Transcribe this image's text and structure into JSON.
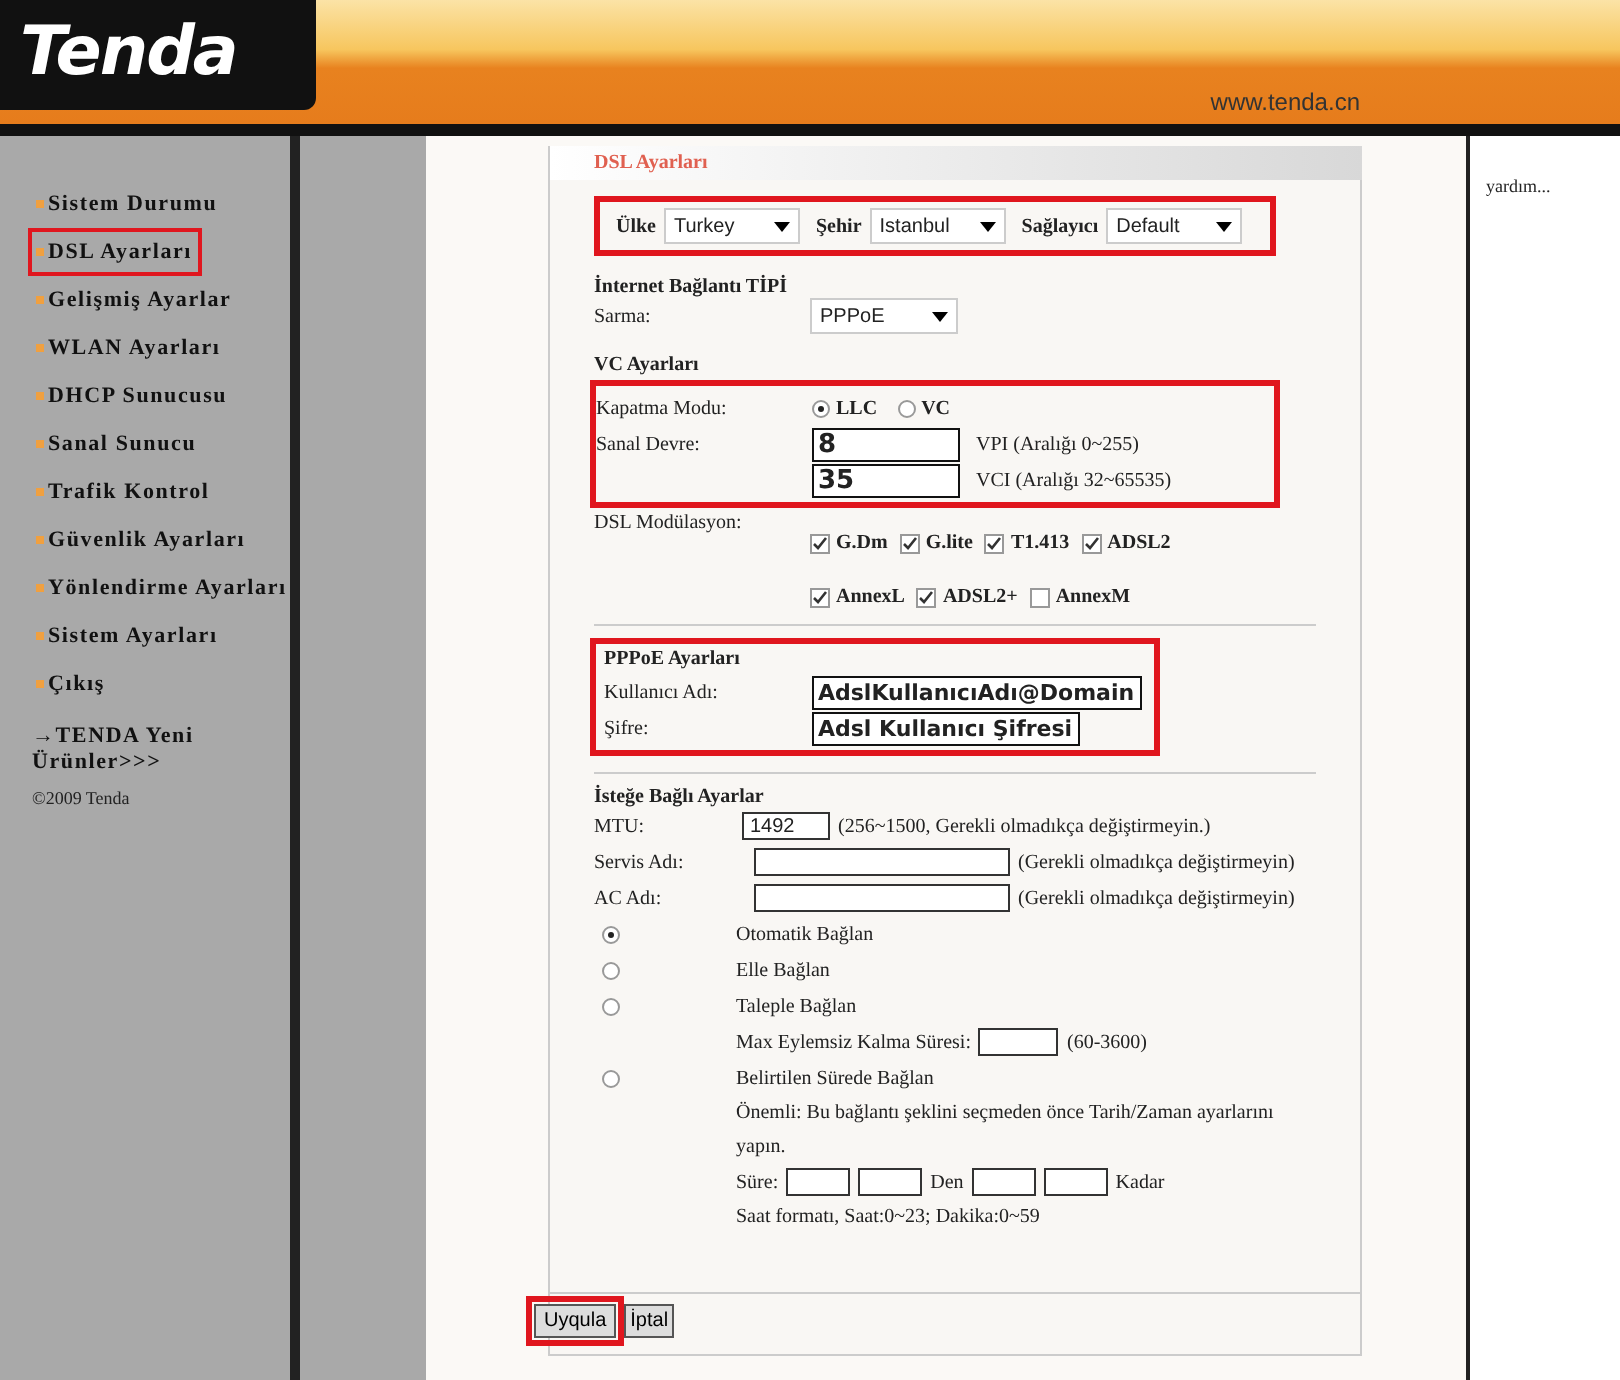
{
  "header": {
    "logo": "Tenda",
    "url": "www.tenda.cn"
  },
  "sidebar": {
    "items": [
      {
        "label": "Sistem Durumu",
        "selected": false
      },
      {
        "label": "DSL Ayarları",
        "selected": true
      },
      {
        "label": "Gelişmiş Ayarlar",
        "selected": false
      },
      {
        "label": "WLAN Ayarları",
        "selected": false
      },
      {
        "label": "DHCP Sunucusu",
        "selected": false
      },
      {
        "label": "Sanal Sunucu",
        "selected": false
      },
      {
        "label": "Trafik Kontrol",
        "selected": false
      },
      {
        "label": "Güvenlik Ayarları",
        "selected": false
      },
      {
        "label": "Yönlendirme Ayarları",
        "selected": false
      },
      {
        "label": "Sistem Ayarları",
        "selected": false
      },
      {
        "label": "Çıkış",
        "selected": false
      }
    ],
    "promo": "→TENDA Yeni Ürünler>>>",
    "copyright": "©2009 Tenda"
  },
  "panel_title": "DSL Ayarları",
  "location": [
    {
      "label": "Ülke",
      "value": "Turkey"
    },
    {
      "label": "Şehir",
      "value": "Istanbul"
    },
    {
      "label": "Sağlayıcı",
      "value": "Default"
    }
  ],
  "connection_type": {
    "heading": "İnternet Bağlantı TİPİ",
    "label": "Sarma:",
    "value": "PPPoE"
  },
  "vc": {
    "heading": "VC Ayarları",
    "mode_label": "Kapatma Modu:",
    "modes": [
      {
        "label": "LLC",
        "selected": true
      },
      {
        "label": "VC",
        "selected": false
      }
    ],
    "circuit_label": "Sanal Devre:",
    "vpi": {
      "value": "8",
      "hint": "VPI (Aralığı 0~255)"
    },
    "vci": {
      "value": "35",
      "hint": "VCI (Aralığı 32~65535)"
    },
    "modulation_label": "DSL Modülasyon:",
    "modulations": [
      {
        "label": "G.Dm",
        "checked": true
      },
      {
        "label": "G.lite",
        "checked": true
      },
      {
        "label": "T1.413",
        "checked": true
      },
      {
        "label": "ADSL2",
        "checked": true
      },
      {
        "label": "AnnexL",
        "checked": true
      },
      {
        "label": "ADSL2+",
        "checked": true
      },
      {
        "label": "AnnexM",
        "checked": false
      }
    ]
  },
  "pppoe": {
    "heading": "PPPoE Ayarları",
    "user_label": "Kullanıcı Adı:",
    "user_value": "AdslKullanıcıAdı@Domain",
    "password_label": "Şifre:",
    "password_value": "Adsl Kullanıcı Şifresi"
  },
  "optional": {
    "heading": "İsteğe Bağlı Ayarlar",
    "mtu": {
      "label": "MTU:",
      "value": "1492",
      "hint": "(256~1500, Gerekli olmadıkça değiştirmeyin.)"
    },
    "service": {
      "label": "Servis Adı:",
      "hint": "(Gerekli olmadıkça değiştirmeyin)"
    },
    "ac": {
      "label": "AC Adı:",
      "hint": "(Gerekli olmadıkça değiştirmeyin)"
    },
    "modes": [
      {
        "label": "Otomatik Bağlan",
        "selected": true
      },
      {
        "label": "Elle Bağlan",
        "selected": false
      },
      {
        "label": "Taleple Bağlan",
        "selected": false
      },
      {
        "label": "Belirtilen Sürede Bağlan",
        "selected": false
      }
    ],
    "idle": {
      "label": "Max Eylemsiz Kalma Süresi:",
      "hint": "(60-3600)"
    },
    "note": "Önemli: Bu bağlantı şeklini seçmeden önce Tarih/Zaman ayarlarını yapın.",
    "time": {
      "label": "Süre:",
      "from": "Den",
      "to": "Kadar"
    },
    "format": "Saat formatı, Saat:0~23; Dakika:0~59"
  },
  "buttons": [
    "Uyqula",
    "İptal"
  ],
  "help": "yardım..."
}
